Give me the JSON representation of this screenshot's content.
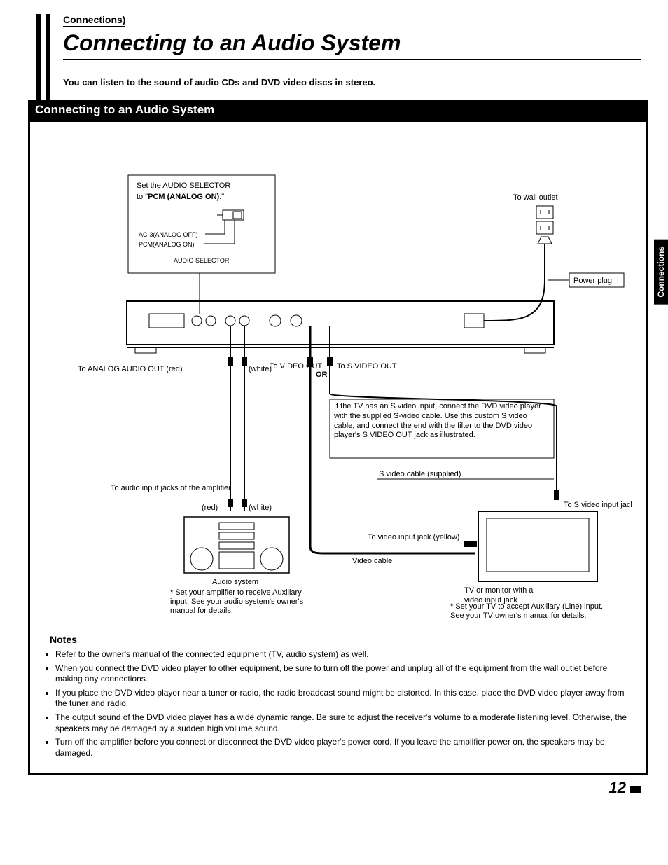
{
  "breadcrumb": "Connections",
  "title": "Connecting to an Audio System",
  "intro": "You can listen to the sound of audio CDs and DVD video discs in stereo.",
  "sectionBar": "Connecting to an Audio System",
  "sideTab": "Connections",
  "pageNumber": "12",
  "diagram": {
    "selector": {
      "line1": "Set the AUDIO SELECTOR",
      "line2a": "to \"",
      "line2b": "PCM (ANALOG ON)",
      "line2c": ".\"",
      "opt1": "AC-3(ANALOG OFF)",
      "opt2": "PCM(ANALOG ON)",
      "caption": "AUDIO SELECTOR"
    },
    "wallOutlet": "To wall outlet",
    "powerPlug": "Power plug",
    "analogOut": {
      "label": "To ANALOG AUDIO OUT",
      "red": "(red)",
      "white": "(white)"
    },
    "videoOut": "To VIDEO OUT",
    "or": "OR",
    "sVideoOut": "To S VIDEO OUT",
    "svideoNote": "If the TV has an S video input, connect the DVD video player with the supplied S-video cable. Use this custom S video cable, and connect the end with the filter to the DVD video player's S VIDEO OUT jack as illustrated.",
    "svideoCable": "S video cable (supplied)",
    "audioInputJacks": "To audio input jacks of the amplifier",
    "red": "(red)",
    "white": "(white)",
    "audioSystem": "Audio system",
    "amplifierNote": "* Set your amplifier to receive Auxiliary input. See your audio system's owner's manual for details.",
    "videoInputJack": "To video input jack (yellow)",
    "videoCable": "Video cable",
    "sVideoInputJack": "To S video input jack",
    "tvLabel": "TV or monitor with a video input jack",
    "tvNote": "* Set your TV to accept Auxiliary (Line) input. See your TV owner's manual for details."
  },
  "notes": {
    "header": "Notes",
    "items": [
      "Refer to the owner's manual of the connected equipment (TV, audio system) as well.",
      "When you connect the DVD video player to other equipment, be sure to turn off the power and unplug all of the equipment from the wall outlet before making any connections.",
      "If you place the DVD video player near a tuner or radio, the radio broadcast sound might be distorted. In this case, place the DVD video player away from the tuner and radio.",
      "The output sound of the DVD video player has a wide dynamic range. Be sure to adjust the receiver's volume to a moderate listening level. Otherwise, the speakers may be damaged by a sudden high volume sound.",
      "Turn off the amplifier before you connect or disconnect the DVD video player's power cord. If you leave the amplifier power on, the speakers may be damaged."
    ]
  }
}
